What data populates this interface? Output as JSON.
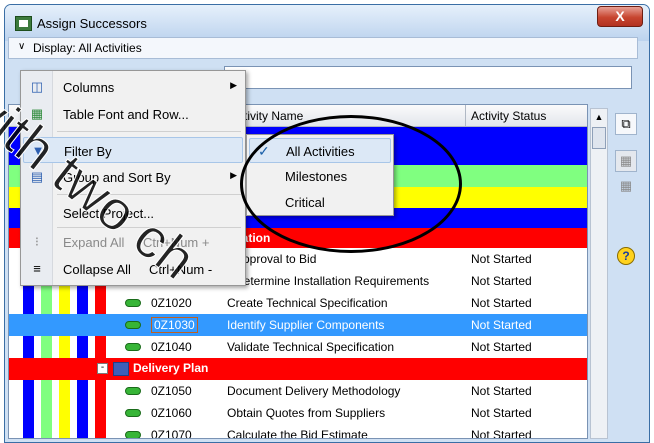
{
  "window": {
    "title": "Assign Successors",
    "close_label": "X"
  },
  "display_bar": {
    "label": "Display: All Activities"
  },
  "columns": {
    "name": "Activity Name",
    "status": "Activity Status"
  },
  "rows": [
    {
      "id": "",
      "name": "Approval to Bid",
      "status": "Not Started"
    },
    {
      "id": "",
      "name": "Determine Installation Requirements",
      "status": "Not Started"
    },
    {
      "id": "0Z1020",
      "name": "Create Technical Specification",
      "status": "Not Started"
    },
    {
      "id": "0Z1030",
      "name": "Identify Supplier Components",
      "status": "Not Started"
    },
    {
      "id": "0Z1040",
      "name": "Validate Technical Specification",
      "status": "Not Started"
    },
    {
      "id": "0Z1050",
      "name": "Document Delivery Methodology",
      "status": "Not Started"
    },
    {
      "id": "0Z1060",
      "name": "Obtain Quotes from Suppliers",
      "status": "Not Started"
    },
    {
      "id": "0Z1070",
      "name": "Calculate the Bid Estimate",
      "status": "Not Started"
    }
  ],
  "group_rows": {
    "spec_label": "cation",
    "plan_label": "Delivery Plan"
  },
  "menu": {
    "items": [
      {
        "label": "Columns",
        "shortcut": "",
        "icon": "columns-icon"
      },
      {
        "label": "Table Font and Row...",
        "shortcut": "",
        "icon": "table-font-icon"
      },
      {
        "label": "Filter By",
        "shortcut": "",
        "icon": "filter-icon"
      },
      {
        "label": "Group and Sort By",
        "shortcut": "",
        "icon": "group-sort-icon"
      },
      {
        "label": "Select Project...",
        "shortcut": "",
        "icon": ""
      },
      {
        "label": "Expand All",
        "shortcut": "Ctrl+Num +",
        "icon": "expand-icon"
      },
      {
        "label": "Collapse All",
        "shortcut": "Ctrl+Num -",
        "icon": "collapse-icon"
      }
    ]
  },
  "submenu": {
    "items": [
      {
        "label": "All Activities",
        "checked": true
      },
      {
        "label": "Milestones",
        "checked": false
      },
      {
        "label": "Critical",
        "checked": false
      }
    ]
  },
  "watermark": {
    "line1": "with two ch"
  },
  "colors": {
    "band_blue": "#0000ff",
    "band_green": "#80ff80",
    "band_yellow": "#ffff00",
    "band_red": "#ff0000",
    "selection": "#3399ff"
  }
}
